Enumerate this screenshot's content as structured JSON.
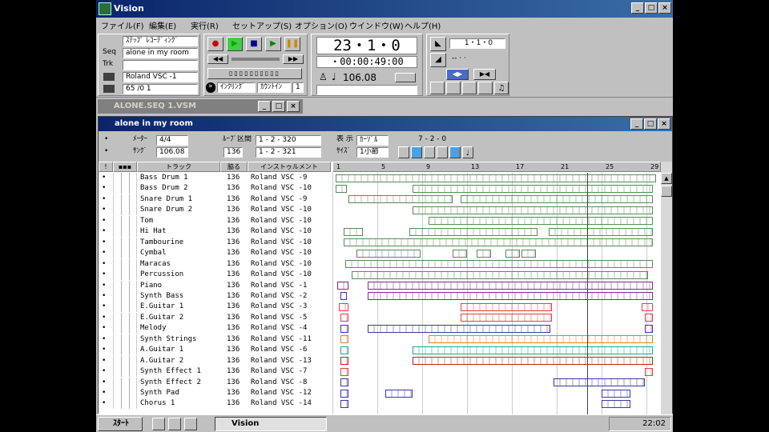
{
  "app": {
    "title": "Vision"
  },
  "menu": [
    "ファイル(F)",
    "編集(E)",
    "実行(R)",
    "セットアップ(S)",
    "オプション(O)",
    "ウインドウ(W)",
    "ヘルプ(H)"
  ],
  "transport": {
    "stop_record_label": "ｽﾃｯﾌﾟ ﾚｺｰﾃﾞｨﾝｸﾞ",
    "seq_name": "alone in my room",
    "trk_value": "",
    "instrument": "Roland VSC -1",
    "prog": "65 /0    1",
    "counter_measure": "23・1・0",
    "counter_time": "・00:00:49:00",
    "tempo": "106.08",
    "position": "1・1・0",
    "click_label": "ｲﾝｸﾘﾝｸﾞ",
    "count_label": "ｶｳﾝﾄｲﾝ",
    "count_value": "1"
  },
  "minimized_window": {
    "title": "ALONE.SEQ 1.VSM"
  },
  "document": {
    "title": "alone in my room",
    "meter_label": "ﾒｰﾀｰ",
    "meter_value": "4/4",
    "song_label": "ｻﾝｸﾞ",
    "song_value": "106.08",
    "loop_label": "ﾙｰﾌﾟ区間",
    "loop_value": "136",
    "loop_start": "1 - 2 - 320",
    "loop_end": "1 - 2 - 321",
    "display_label": "表 示",
    "display_value": "ｶｰｿﾞﾙ",
    "size_label": "ｻｲｽﾞ",
    "size_value": "1小節",
    "cursor_pos": "7 - 2 - 0"
  },
  "columns": {
    "track": "トラック",
    "ch": "脇る",
    "instrument": "インストゥルメント"
  },
  "ruler": [
    "1",
    "5",
    "9",
    "13",
    "17",
    "21",
    "25",
    "29"
  ],
  "tracks": [
    {
      "name": "Bass Drum 1",
      "ch": "136",
      "inst": "Roland VSC -9"
    },
    {
      "name": "Bass Drum 2",
      "ch": "136",
      "inst": "Roland VSC -10"
    },
    {
      "name": "Snare Drum 1",
      "ch": "136",
      "inst": "Roland VSC -9"
    },
    {
      "name": "Snare Drum 2",
      "ch": "136",
      "inst": "Roland VSC -10"
    },
    {
      "name": "Tom",
      "ch": "136",
      "inst": "Roland VSC -10"
    },
    {
      "name": "Hi Hat",
      "ch": "136",
      "inst": "Roland VSC -10"
    },
    {
      "name": "Tambourine",
      "ch": "136",
      "inst": "Roland VSC -10"
    },
    {
      "name": "Cymbal",
      "ch": "136",
      "inst": "Roland VSC -10"
    },
    {
      "name": "Maracas",
      "ch": "136",
      "inst": "Roland VSC -10"
    },
    {
      "name": "Percussion",
      "ch": "136",
      "inst": "Roland VSC -10"
    },
    {
      "name": "Piano",
      "ch": "136",
      "inst": "Roland VSC -1"
    },
    {
      "name": "Synth Bass",
      "ch": "136",
      "inst": "Roland VSC -2"
    },
    {
      "name": "E.Guitar 1",
      "ch": "136",
      "inst": "Roland VSC -3"
    },
    {
      "name": "E.Guitar 2",
      "ch": "136",
      "inst": "Roland VSC -5"
    },
    {
      "name": "Melody",
      "ch": "136",
      "inst": "Roland VSC -4"
    },
    {
      "name": "Synth Strings",
      "ch": "136",
      "inst": "Roland VSC -11"
    },
    {
      "name": "A.Guitar 1",
      "ch": "136",
      "inst": "Roland VSC -6"
    },
    {
      "name": "A.Guitar 2",
      "ch": "136",
      "inst": "Roland VSC -13"
    },
    {
      "name": "Synth Effect 1",
      "ch": "136",
      "inst": "Roland VSC -7"
    },
    {
      "name": "Synth Effect 2",
      "ch": "136",
      "inst": "Roland VSC -8"
    },
    {
      "name": "Synth Pad",
      "ch": "136",
      "inst": "Roland VSC -12"
    },
    {
      "name": "Chorus 1",
      "ch": "136",
      "inst": "Roland VSC -14"
    }
  ],
  "taskbar": {
    "start": "ｽﾀｰﾄ",
    "app": "Vision",
    "clock": "22:02"
  },
  "colors": {
    "title_bg": "#0a246a",
    "drum_seg": "#5a8a5a",
    "piano_seg": "#7a2a8a",
    "guitar_seg": "#e04040",
    "melody_seg": "#3a3aa0",
    "strings_seg": "#e08030",
    "aguitar_seg": "#20a0a0",
    "aguitar2_seg": "#c02020"
  }
}
